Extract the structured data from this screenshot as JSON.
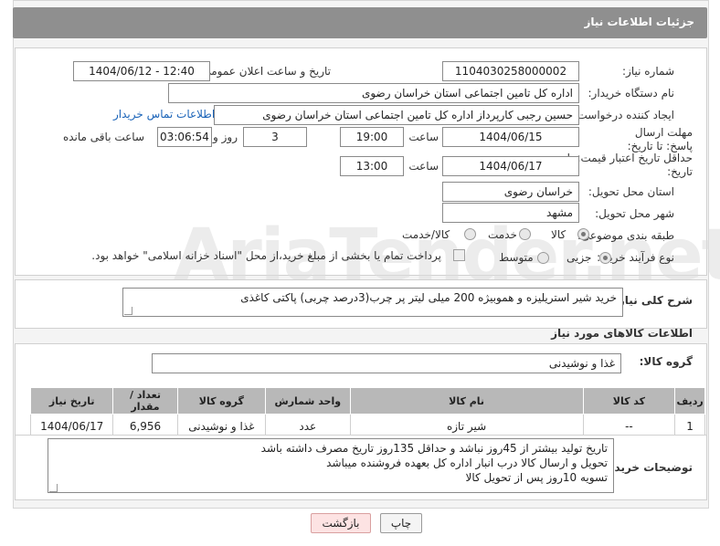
{
  "header": {
    "title": "جزئیات اطلاعات نیاز"
  },
  "form": {
    "need_number_label": "شماره نیاز:",
    "need_number": "1104030258000002",
    "announce_label": "تاریخ و ساعت اعلان عمومی:",
    "announce_value": "1404/06/12 - 12:40",
    "buyer_org_label": "نام دستگاه خریدار:",
    "buyer_org": "اداره کل تامین اجتماعی استان خراسان رضوی",
    "creator_label": "ایجاد کننده درخواست:",
    "creator": "حسین رجبی کارپرداز اداره کل تامین اجتماعی استان خراسان رضوی",
    "contact_link": "اطلاعات تماس خریدار",
    "deadline_label": "مهلت ارسال پاسخ: تا تاریخ:",
    "deadline_date": "1404/06/15",
    "time_label": "ساعت",
    "deadline_time": "19:00",
    "days_value": "3",
    "days_label": "روز و",
    "remaining_time": "03:06:54",
    "remaining_label": "ساعت باقی مانده",
    "validity_label": "حداقل تاریخ اعتبار قیمت: تا تاریخ:",
    "validity_date": "1404/06/17",
    "validity_time": "13:00",
    "province_label": "استان محل تحویل:",
    "province": "خراسان رضوی",
    "city_label": "شهر محل تحویل:",
    "city": "مشهد",
    "category_label": "طبقه بندی موضوعی:",
    "category_options": [
      "کالا",
      "خدمت",
      "کالا/خدمت"
    ],
    "process_label": "نوع فرآیند خرید :",
    "process_options": [
      "جزیی",
      "متوسط"
    ],
    "payment_note": "پرداخت تمام یا بخشی از مبلغ خرید،از محل \"اسناد خزانه اسلامی\" خواهد بود."
  },
  "description": {
    "label": "شرح کلی نیاز:",
    "value": "خرید شیر استریلیزه  و هموبیژه 200 میلی لیتر پر چرب(3درصد چربی) پاکتی کاغذی"
  },
  "goods": {
    "section_title": "اطلاعات کالاهای مورد نیاز",
    "group_label": "گروه کالا:",
    "group_value": "غذا و نوشیدنی",
    "columns": [
      "ردیف",
      "کد کالا",
      "نام کالا",
      "واحد شمارش",
      "گروه کالا",
      "تعداد / مقدار",
      "تاریخ نیاز"
    ],
    "rows": [
      [
        "1",
        "--",
        "شیر تازه",
        "عدد",
        "غذا و نوشیدنی",
        "6,956",
        "1404/06/17"
      ]
    ]
  },
  "buyer_notes": {
    "label": "توضیحات خریدار:",
    "lines": [
      "تاریخ تولید بیشتر از 45روز نباشد و حداقل 135روز تاریخ مصرف داشته باشد",
      "تحویل و ارسال کالا درب انبار اداره کل بعهده فروشنده میباشد",
      "تسویه 10روز پس از تحویل کالا"
    ]
  },
  "buttons": {
    "print": "چاپ",
    "back": "بازگشت"
  },
  "watermark": {
    "brand": "AriaTender.net"
  }
}
